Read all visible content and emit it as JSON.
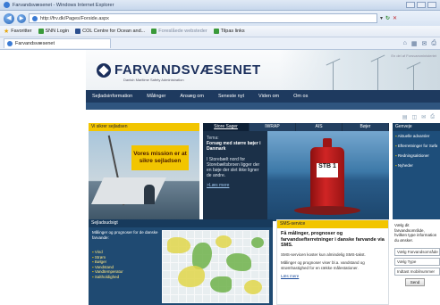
{
  "window": {
    "title": "Farvandsvæsenet - Windows Internet Explorer"
  },
  "address": {
    "url": "http://frv.dk/Pages/Forside.aspx"
  },
  "favorites": [
    {
      "label": "Favoritter"
    },
    {
      "label": "SNN Login"
    },
    {
      "label": "COL Centre for Ocean and..."
    },
    {
      "label": "Foreslåede websteder"
    },
    {
      "label": "Tilpas links"
    }
  ],
  "tab": {
    "label": "Farvandsvæsenet"
  },
  "header": {
    "brand": "FARVANDSVÆSENET",
    "tagline": "Danish Maritime Safety Administration",
    "corner": "En del af Forsvarsministeriet"
  },
  "nav": [
    "Sejladsinformation",
    "Målinger",
    "Ansæg om",
    "Seneste nyt",
    "Viden om",
    "Om os"
  ],
  "safe": {
    "head": "Vi sikrer sejladsen",
    "promo": "Vores mission er at sikre sejladsen"
  },
  "news": {
    "tabs": [
      "Store Sager",
      "IWRAP",
      "AIS",
      "Bøjer"
    ],
    "kicker": "Tema:",
    "headline": "Forsøg med større bøjer i Danmark",
    "body": "I Storebælt nord for Storebæltsbroen ligger der en bøje der slet ikke ligner de andre.",
    "link": ">Læs mere",
    "buoy_label": "STB 1"
  },
  "links": {
    "head": "Genveje",
    "items": [
      "Aktuelle advarsler",
      "Efterretninger for Søfarende",
      "Redningsaktioner",
      "Nyheder"
    ]
  },
  "forecast": {
    "head": "Sejladsudsigt",
    "intro": "Målinger og prognoser for de danske farvande:",
    "items": [
      "Vind",
      "Strøm",
      "Bølger",
      "Vandstand",
      "Vandtemperatur",
      "Saltholdighed"
    ]
  },
  "sms": {
    "head": "SMS-service",
    "title": "Få målinger, prognoser og farvandsefterretninger i danske farvande via SMS.",
    "text1": "SMS-servicen koster kun almindelig SMS-takst.",
    "text2": "Målinger og prognoser viser bl.a. vandstand og strømhastighed for en række målestationer.",
    "link": "Læs mere"
  },
  "form": {
    "intro": "Vælg dit farvandsområde, hvilken type information du ønsker.",
    "field1": "Vælg Farvandsområde",
    "field2": "Vælg Type",
    "field3": "Indtast mobilnummer",
    "send": "Send"
  }
}
